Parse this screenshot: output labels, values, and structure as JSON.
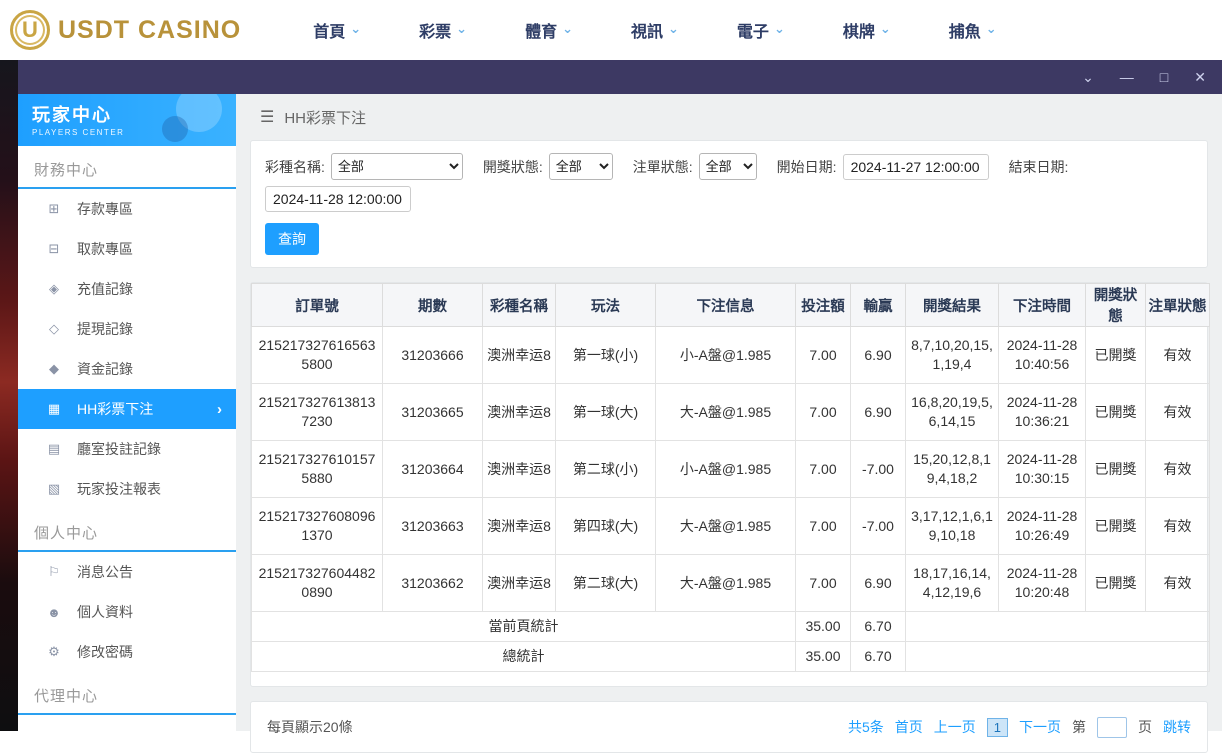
{
  "topnav": {
    "brand": "USDT CASINO",
    "logo_letter": "U",
    "chevron": "⌄",
    "items": [
      "首頁",
      "彩票",
      "體育",
      "視訊",
      "電子",
      "棋牌",
      "捕魚"
    ]
  },
  "window": {
    "controls": {
      "chevron": "⌄",
      "minimize": "—",
      "maximize": "□",
      "close": "✕"
    }
  },
  "sidebar": {
    "title": "玩家中心",
    "subtitle": "PLAYERS CENTER",
    "sections": [
      {
        "label": "財務中心",
        "items": [
          {
            "label": "存款專區",
            "glyph": "⊞"
          },
          {
            "label": "取款專區",
            "glyph": "⊟"
          },
          {
            "label": "充值記錄",
            "glyph": "◈"
          },
          {
            "label": "提現記錄",
            "glyph": "◇"
          },
          {
            "label": "資金記錄",
            "glyph": "◆"
          },
          {
            "label": "HH彩票下注",
            "glyph": "▦",
            "chevron": "›"
          },
          {
            "label": "廳室投註記錄",
            "glyph": "▤"
          },
          {
            "label": "玩家投注報表",
            "glyph": "▧"
          }
        ]
      },
      {
        "label": "個人中心",
        "items": [
          {
            "label": "消息公告",
            "glyph": "⚐"
          },
          {
            "label": "個人資料",
            "glyph": "☻"
          },
          {
            "label": "修改密碼",
            "glyph": "⚙"
          }
        ]
      },
      {
        "label": "代理中心",
        "items": []
      }
    ]
  },
  "breadcrumb": {
    "menu_icon": "☰",
    "title": "HH彩票下注"
  },
  "filters": {
    "lottery_label": "彩種名稱:",
    "lottery_value": "全部",
    "draw_status_label": "開獎狀態:",
    "draw_status_value": "全部",
    "order_status_label": "注單狀態:",
    "order_status_value": "全部",
    "start_label": "開始日期:",
    "start_value": "2024-11-27 12:00:00",
    "end_label": "結束日期:",
    "end_value": "2024-11-28 12:00:00",
    "search_button": "查詢"
  },
  "table": {
    "headers": [
      "訂單號",
      "期數",
      "彩種名稱",
      "玩法",
      "下注信息",
      "投注額",
      "輸贏",
      "開獎結果",
      "下注時間",
      "開獎狀態",
      "注單狀態"
    ],
    "rows": [
      {
        "order_id": "2152173276165635800",
        "period": "31203666",
        "lottery": "澳洲幸运8",
        "play": "第一球(小)",
        "bet_info": "小-A盤@1.985",
        "amount": "7.00",
        "win": "6.90",
        "result": "8,7,10,20,15,1,19,4",
        "time": "2024-11-28 10:40:56",
        "draw_status": "已開獎",
        "order_status": "有效"
      },
      {
        "order_id": "2152173276138137230",
        "period": "31203665",
        "lottery": "澳洲幸运8",
        "play": "第一球(大)",
        "bet_info": "大-A盤@1.985",
        "amount": "7.00",
        "win": "6.90",
        "result": "16,8,20,19,5,6,14,15",
        "time": "2024-11-28 10:36:21",
        "draw_status": "已開獎",
        "order_status": "有效"
      },
      {
        "order_id": "2152173276101575880",
        "period": "31203664",
        "lottery": "澳洲幸运8",
        "play": "第二球(小)",
        "bet_info": "小-A盤@1.985",
        "amount": "7.00",
        "win": "-7.00",
        "result": "15,20,12,8,19,4,18,2",
        "time": "2024-11-28 10:30:15",
        "draw_status": "已開獎",
        "order_status": "有效"
      },
      {
        "order_id": "2152173276080961370",
        "period": "31203663",
        "lottery": "澳洲幸运8",
        "play": "第四球(大)",
        "bet_info": "大-A盤@1.985",
        "amount": "7.00",
        "win": "-7.00",
        "result": "3,17,12,1,6,19,10,18",
        "time": "2024-11-28 10:26:49",
        "draw_status": "已開獎",
        "order_status": "有效"
      },
      {
        "order_id": "2152173276044820890",
        "period": "31203662",
        "lottery": "澳洲幸运8",
        "play": "第二球(大)",
        "bet_info": "大-A盤@1.985",
        "amount": "7.00",
        "win": "6.90",
        "result": "18,17,16,14,4,12,19,6",
        "time": "2024-11-28 10:20:48",
        "draw_status": "已開獎",
        "order_status": "有效"
      }
    ],
    "summary": [
      {
        "label": "當前頁統計",
        "amount": "35.00",
        "win": "6.70"
      },
      {
        "label": "總統計",
        "amount": "35.00",
        "win": "6.70"
      }
    ]
  },
  "pagination": {
    "page_size_text": "每頁顯示20條",
    "total_text": "共5条",
    "first": "首页",
    "prev": "上一页",
    "current": "1",
    "next": "下一页",
    "jump_prefix": "第",
    "jump_suffix": "页",
    "jump_button": "跳转",
    "jump_value": ""
  },
  "colors": {
    "accent": "#1e9fff",
    "titlebar": "#3d3963",
    "brand_gold": "#b8923a"
  }
}
